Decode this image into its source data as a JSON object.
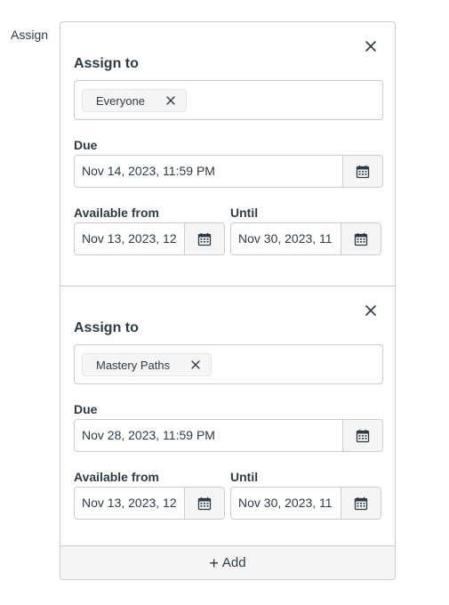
{
  "side_label": "Assign",
  "cards": [
    {
      "assign_to_label": "Assign to",
      "assignee": "Everyone",
      "due_label": "Due",
      "due_value": "Nov 14, 2023, 11:59 PM",
      "available_from_label": "Available from",
      "available_from_value": "Nov 13, 2023, 12",
      "until_label": "Until",
      "until_value": "Nov 30, 2023, 11"
    },
    {
      "assign_to_label": "Assign to",
      "assignee": "Mastery Paths",
      "due_label": "Due",
      "due_value": "Nov 28, 2023, 11:59 PM",
      "available_from_label": "Available from",
      "available_from_value": "Nov 13, 2023, 12",
      "until_label": "Until",
      "until_value": "Nov 30, 2023, 11"
    }
  ],
  "add_button": {
    "icon": "plus-icon",
    "label": "Add"
  },
  "icons": {
    "close": "close-icon",
    "tag_remove": "x-icon",
    "calendar": "calendar-icon"
  },
  "colors": {
    "text": "#2d3b45",
    "border": "#c7cdd1",
    "button_bg": "#f5f5f5"
  }
}
